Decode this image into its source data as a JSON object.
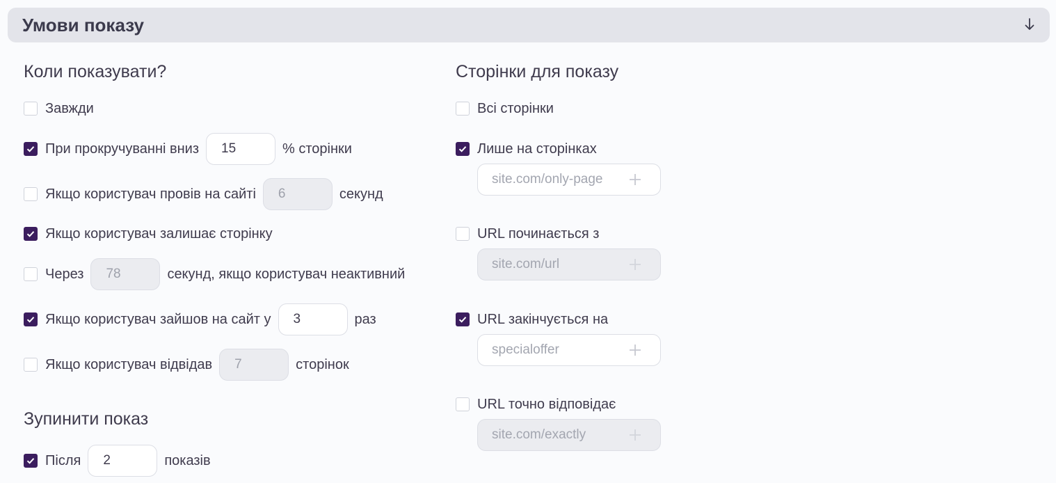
{
  "section": {
    "title": "Умови показу",
    "toggle_icon": "arrow-down-icon"
  },
  "when": {
    "title": "Коли показувати?",
    "always": {
      "label": "Завжди",
      "checked": false
    },
    "scroll": {
      "label_before": "При прокручуванні вниз",
      "value": "15",
      "label_after": "% сторінки",
      "checked": true
    },
    "time_on_site": {
      "label_before": "Якщо користувач провів на сайті",
      "value": "6",
      "label_after": "секунд",
      "checked": false
    },
    "exit_intent": {
      "label": "Якщо користувач залишає сторінку",
      "checked": true
    },
    "inactive": {
      "label_before": "Через",
      "value": "78",
      "label_after": "секунд, якщо користувач неактивний",
      "checked": false
    },
    "visits": {
      "label_before": "Якщо користувач зайшов на сайт у",
      "value": "3",
      "label_after": "раз",
      "checked": true
    },
    "pages_viewed": {
      "label_before": "Якщо користувач відвідав",
      "value": "7",
      "label_after": "сторінок",
      "checked": false
    }
  },
  "stop": {
    "title": "Зупинити показ",
    "after": {
      "label_before": "Після",
      "value": "2",
      "label_after": "показів",
      "checked": true
    }
  },
  "pages": {
    "title": "Сторінки для показу",
    "all_pages": {
      "label": "Всі сторінки",
      "checked": false
    },
    "only_pages": {
      "label": "Лише на сторінках",
      "checked": true,
      "placeholder": "site.com/only-page"
    },
    "url_starts": {
      "label": "URL починається з",
      "checked": false,
      "placeholder": "site.com/url"
    },
    "url_ends": {
      "label": "URL закінчується на",
      "checked": true,
      "placeholder": "specialoffer"
    },
    "url_exact": {
      "label": "URL точно відповідає",
      "checked": false,
      "placeholder": "site.com/exactly"
    }
  },
  "colors": {
    "checkbox_checked": "#3b1d5e",
    "header_background": "#e3e4ea",
    "page_background": "#fafbfd"
  }
}
